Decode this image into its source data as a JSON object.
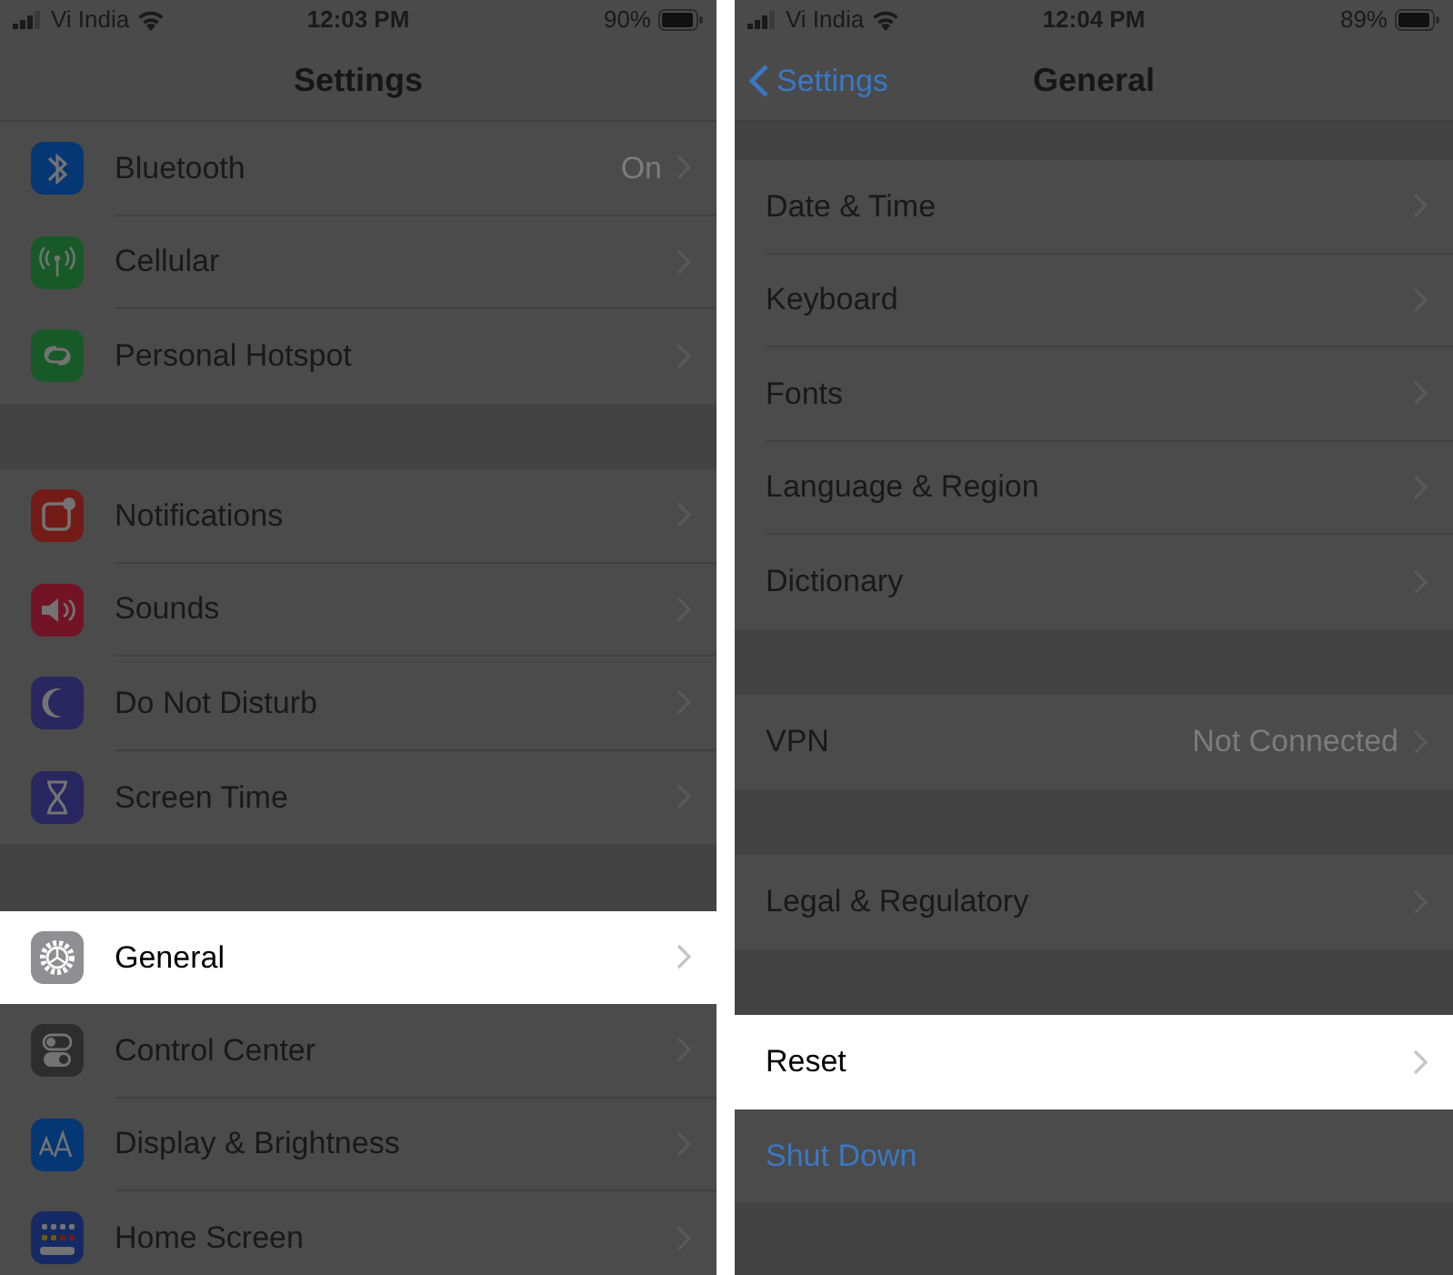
{
  "screens": [
    {
      "status_bar": {
        "carrier": "Vi India",
        "time": "12:03 PM",
        "battery": "90%"
      },
      "nav": {
        "title": "Settings"
      },
      "groups": [
        {
          "rows": [
            {
              "label": "Bluetooth",
              "value": "On",
              "kind": "nav",
              "selected": false
            },
            {
              "label": "Cellular",
              "kind": "nav",
              "selected": false
            },
            {
              "label": "Personal Hotspot",
              "kind": "nav",
              "selected": false
            }
          ]
        },
        {
          "rows": [
            {
              "label": "Notifications",
              "kind": "nav",
              "selected": false
            },
            {
              "label": "Sounds",
              "kind": "nav",
              "selected": false
            },
            {
              "label": "Do Not Disturb",
              "kind": "nav",
              "selected": false
            },
            {
              "label": "Screen Time",
              "kind": "nav",
              "selected": false
            }
          ]
        },
        {
          "rows": [
            {
              "label": "General",
              "kind": "nav",
              "selected": true
            },
            {
              "label": "Control Center",
              "kind": "nav",
              "selected": false
            },
            {
              "label": "Display & Brightness",
              "kind": "nav",
              "selected": false
            },
            {
              "label": "Home Screen",
              "kind": "nav",
              "selected": false
            }
          ]
        }
      ]
    },
    {
      "status_bar": {
        "carrier": "Vi India",
        "time": "12:04 PM",
        "battery": "89%"
      },
      "nav": {
        "back": "Settings",
        "title": "General"
      },
      "groups": [
        {
          "rows": [
            {
              "label": "Date & Time",
              "kind": "nav",
              "selected": false
            },
            {
              "label": "Keyboard",
              "kind": "nav",
              "selected": false
            },
            {
              "label": "Fonts",
              "kind": "nav",
              "selected": false
            },
            {
              "label": "Language & Region",
              "kind": "nav",
              "selected": false
            },
            {
              "label": "Dictionary",
              "kind": "nav",
              "selected": false
            }
          ]
        },
        {
          "rows": [
            {
              "label": "VPN",
              "value": "Not Connected",
              "kind": "nav",
              "selected": false
            }
          ]
        },
        {
          "rows": [
            {
              "label": "Legal & Regulatory",
              "kind": "nav",
              "selected": false
            }
          ]
        },
        {
          "rows": [
            {
              "label": "Reset",
              "kind": "nav",
              "selected": true
            },
            {
              "label": "Shut Down",
              "kind": "action",
              "selected": false
            }
          ]
        }
      ]
    }
  ]
}
